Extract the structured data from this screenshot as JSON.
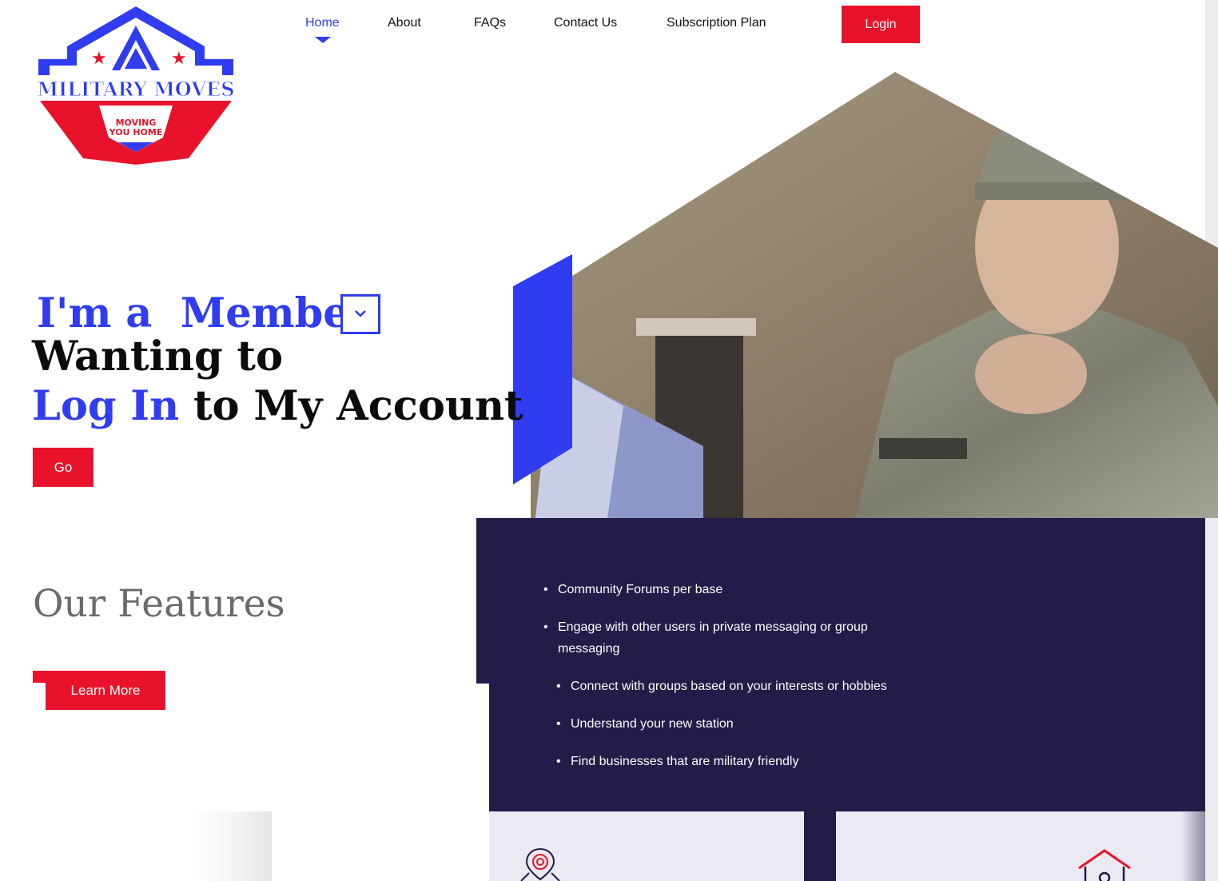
{
  "logo": {
    "title": "MILITARY MOVES",
    "tagline_line1": "MOVING",
    "tagline_line2": "YOU HOME"
  },
  "nav": {
    "items": [
      {
        "label": "Home",
        "active": true
      },
      {
        "label": "About"
      },
      {
        "label": "FAQs"
      },
      {
        "label": "Contact Us"
      },
      {
        "label": "Subscription Plan"
      }
    ],
    "login_label": "Login"
  },
  "hero": {
    "line1_prefix": "I'm a",
    "role": "Member",
    "line2": "Wanting to",
    "line3_highlight": "Log In",
    "line3_rest": "to My Account",
    "go_label": "Go",
    "image_name": "soldier-holding-keys-photo"
  },
  "features": {
    "title": "Our Features",
    "learn_more_label": "Learn More",
    "items": [
      "Community Forums per base",
      "Engage with other users in private messaging or group messaging",
      "Connect with groups based on your interests or hobbies",
      "Understand your new station",
      "Find businesses that are military friendly"
    ]
  },
  "icons": {
    "role_dropdown": "chevron-down-icon",
    "card1": "location-pin-icon",
    "card2": "house-icon"
  },
  "colors": {
    "brand_blue": "#2f3cf0",
    "brand_red": "#e8132b",
    "panel_dark": "#231b48",
    "card_bg": "#ebe9f1"
  }
}
